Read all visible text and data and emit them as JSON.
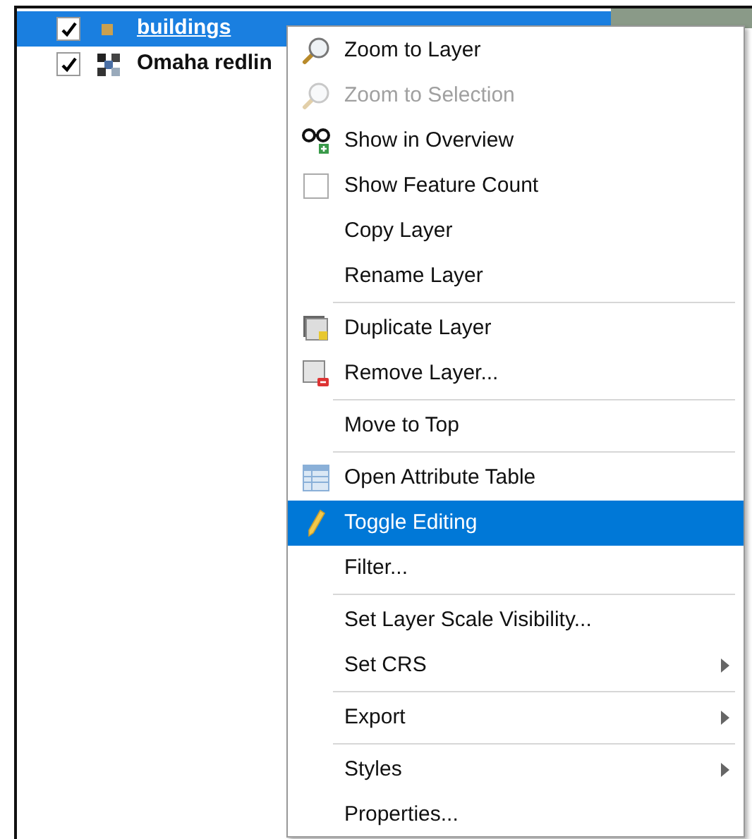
{
  "layers": [
    {
      "name": "buildings",
      "checked": true,
      "selected": true
    },
    {
      "name": "Omaha redlin",
      "checked": true,
      "selected": false
    }
  ],
  "menu": {
    "items": [
      {
        "kind": "item",
        "label": "Zoom to Layer",
        "disabled": false,
        "selected": false,
        "submenu": false
      },
      {
        "kind": "item",
        "label": "Zoom to Selection",
        "disabled": true,
        "selected": false,
        "submenu": false
      },
      {
        "kind": "item",
        "label": "Show in Overview",
        "disabled": false,
        "selected": false,
        "submenu": false
      },
      {
        "kind": "check",
        "label": "Show Feature Count",
        "checked": false
      },
      {
        "kind": "item",
        "label": "Copy Layer",
        "disabled": false,
        "selected": false,
        "submenu": false
      },
      {
        "kind": "item",
        "label": "Rename Layer",
        "disabled": false,
        "selected": false,
        "submenu": false
      },
      {
        "kind": "separator"
      },
      {
        "kind": "item",
        "label": "Duplicate Layer",
        "disabled": false,
        "selected": false,
        "submenu": false
      },
      {
        "kind": "item",
        "label": "Remove Layer...",
        "disabled": false,
        "selected": false,
        "submenu": false
      },
      {
        "kind": "separator"
      },
      {
        "kind": "item",
        "label": "Move to Top",
        "disabled": false,
        "selected": false,
        "submenu": false
      },
      {
        "kind": "separator"
      },
      {
        "kind": "item",
        "label": "Open Attribute Table",
        "disabled": false,
        "selected": false,
        "submenu": false
      },
      {
        "kind": "item",
        "label": "Toggle Editing",
        "disabled": false,
        "selected": true,
        "submenu": false
      },
      {
        "kind": "item",
        "label": "Filter...",
        "disabled": false,
        "selected": false,
        "submenu": false
      },
      {
        "kind": "separator"
      },
      {
        "kind": "item",
        "label": "Set Layer Scale Visibility...",
        "disabled": false,
        "selected": false,
        "submenu": false
      },
      {
        "kind": "item",
        "label": "Set CRS",
        "disabled": false,
        "selected": false,
        "submenu": true
      },
      {
        "kind": "separator"
      },
      {
        "kind": "item",
        "label": "Export",
        "disabled": false,
        "selected": false,
        "submenu": true
      },
      {
        "kind": "separator"
      },
      {
        "kind": "item",
        "label": "Styles",
        "disabled": false,
        "selected": false,
        "submenu": true
      },
      {
        "kind": "item",
        "label": "Properties...",
        "disabled": false,
        "selected": false,
        "submenu": false
      }
    ]
  }
}
